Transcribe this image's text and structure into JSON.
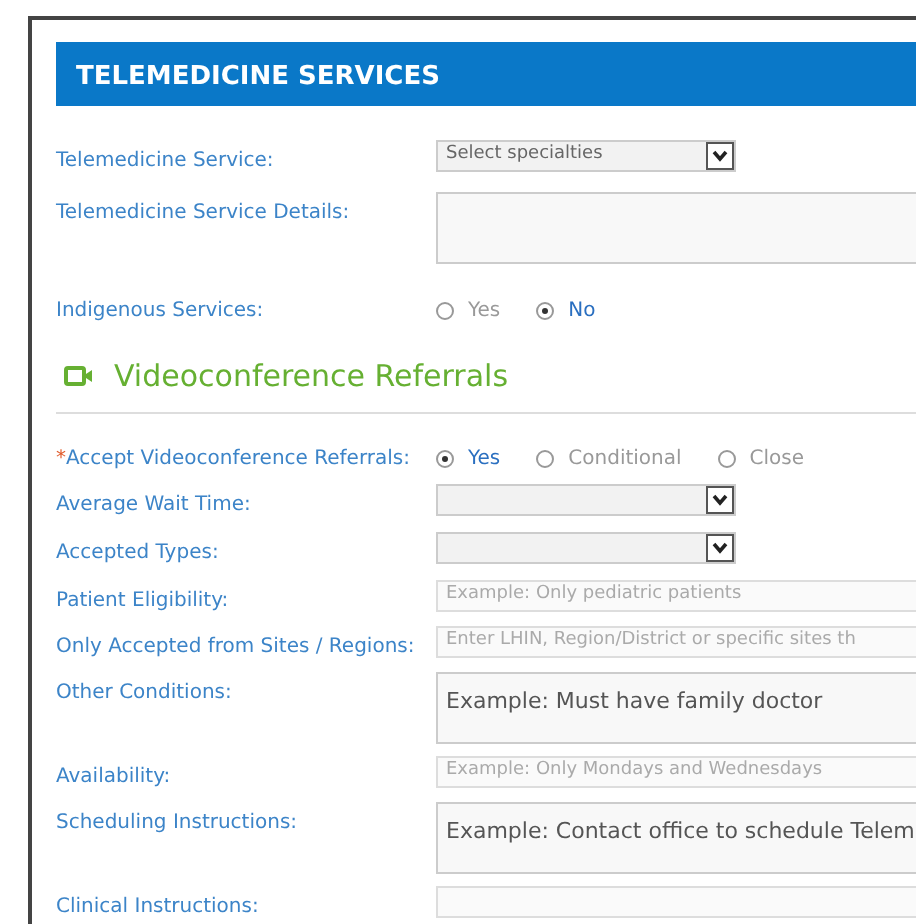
{
  "section_title": "TELEMEDICINE SERVICES",
  "fields": [
    {
      "kind": "select",
      "label": "Telemedicine Service:",
      "value": "Select specialties"
    },
    {
      "kind": "textarea",
      "label": "Telemedicine Service Details:"
    },
    {
      "kind": "radio",
      "label": "Indigenous Services:",
      "options": [
        {
          "label": "Yes",
          "selected": false
        },
        {
          "label": "No",
          "selected": true
        }
      ]
    }
  ],
  "subsection": {
    "title": "Videoconference Referrals"
  },
  "referral_fields": [
    {
      "kind": "radio",
      "label": "Accept Videoconference Referrals:",
      "required_mark": "*",
      "options": [
        {
          "label": "Yes",
          "selected": true
        },
        {
          "label": "Conditional",
          "selected": false
        },
        {
          "label": "Close",
          "selected": false
        }
      ]
    },
    {
      "kind": "select",
      "label": "Average Wait Time:"
    },
    {
      "kind": "select",
      "label": "Accepted Types:"
    },
    {
      "kind": "text",
      "label": "Patient Eligibility:",
      "placeholder": "Example: Only pediatric patients"
    },
    {
      "kind": "text",
      "label": "Only Accepted from Sites / Regions:",
      "placeholder": "Enter LHIN, Region/District or specific sites th"
    },
    {
      "kind": "textarea",
      "label": "Other Conditions:",
      "placeholder": "Example: Must have family doctor"
    },
    {
      "kind": "text",
      "label": "Availability:",
      "placeholder": "Example: Only Mondays and Wednesdays"
    },
    {
      "kind": "textarea",
      "label": "Scheduling Instructions:",
      "placeholder": "Example: Contact office to schedule Telem"
    },
    {
      "kind": "text",
      "label": "Clinical Instructions:"
    }
  ]
}
